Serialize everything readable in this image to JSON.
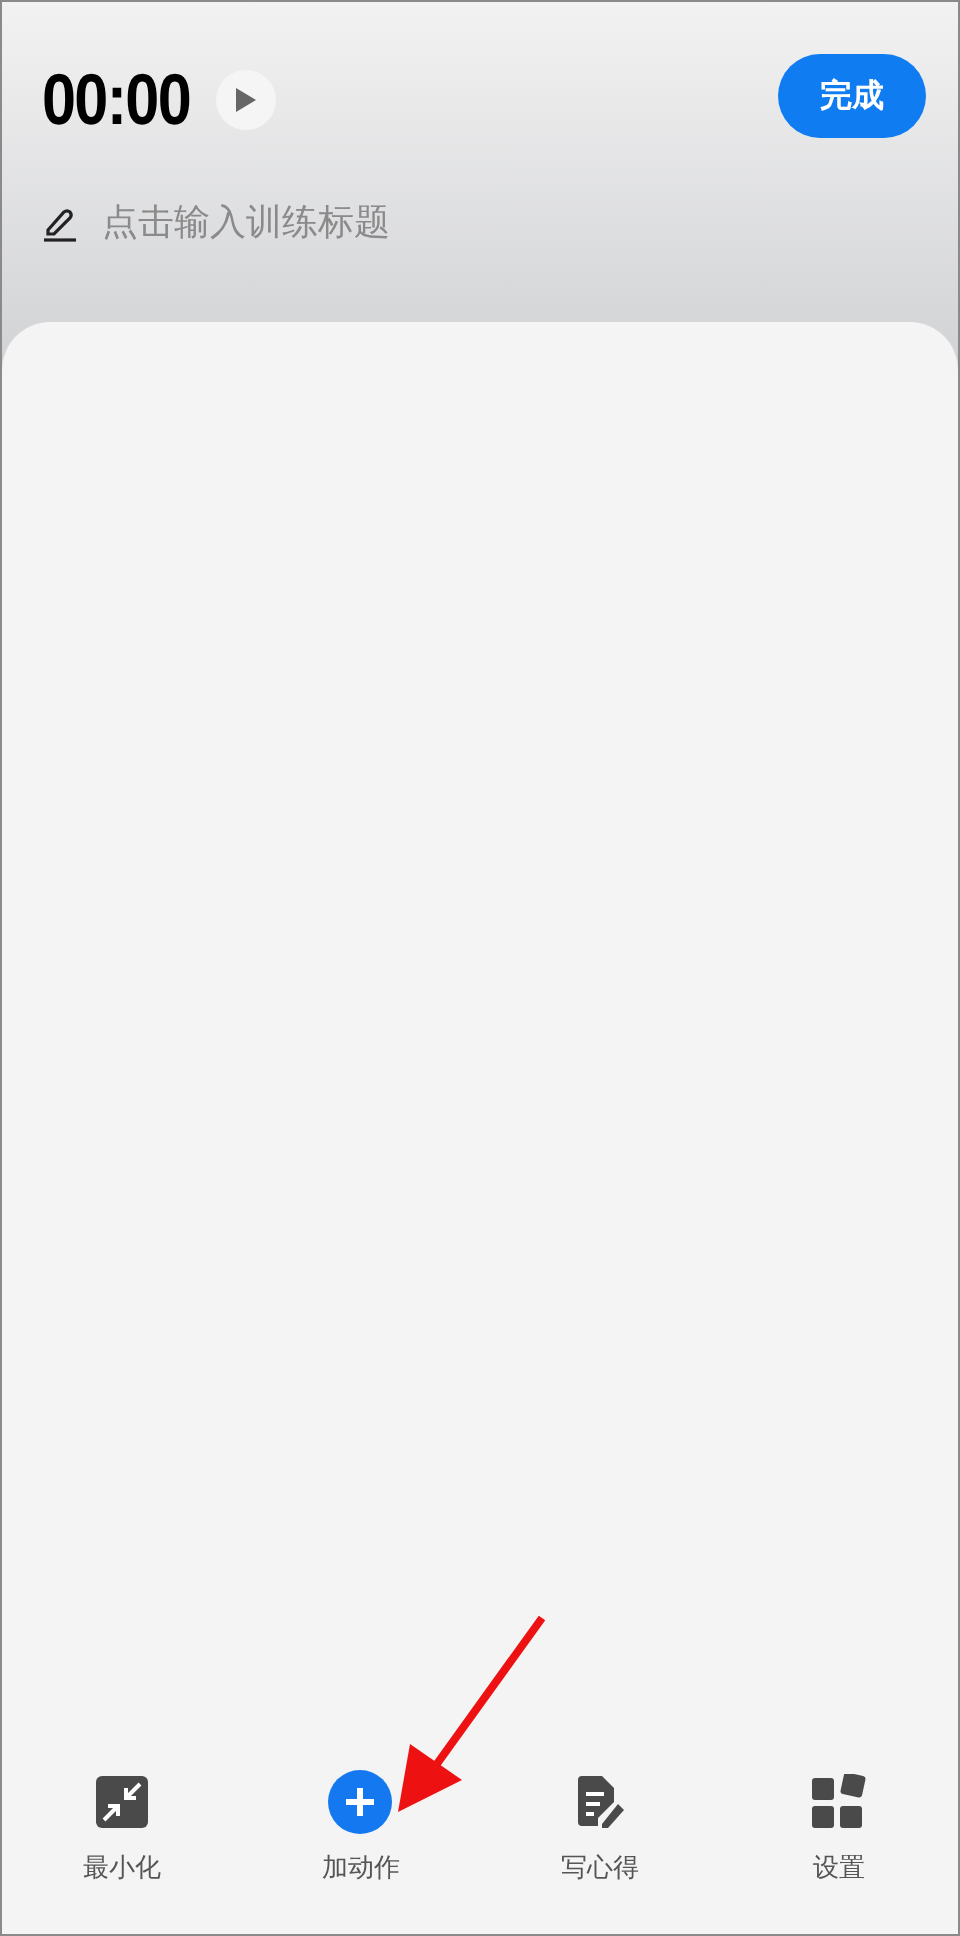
{
  "timer": {
    "time": "00:00",
    "running": false
  },
  "done_button": {
    "label": "完成"
  },
  "title_field": {
    "placeholder": "点击输入训练标题"
  },
  "bottom_nav": [
    {
      "kind": "minimize",
      "label": "最小化"
    },
    {
      "kind": "add",
      "label": "加动作"
    },
    {
      "kind": "note",
      "label": "写心得"
    },
    {
      "kind": "settings",
      "label": "设置"
    }
  ]
}
